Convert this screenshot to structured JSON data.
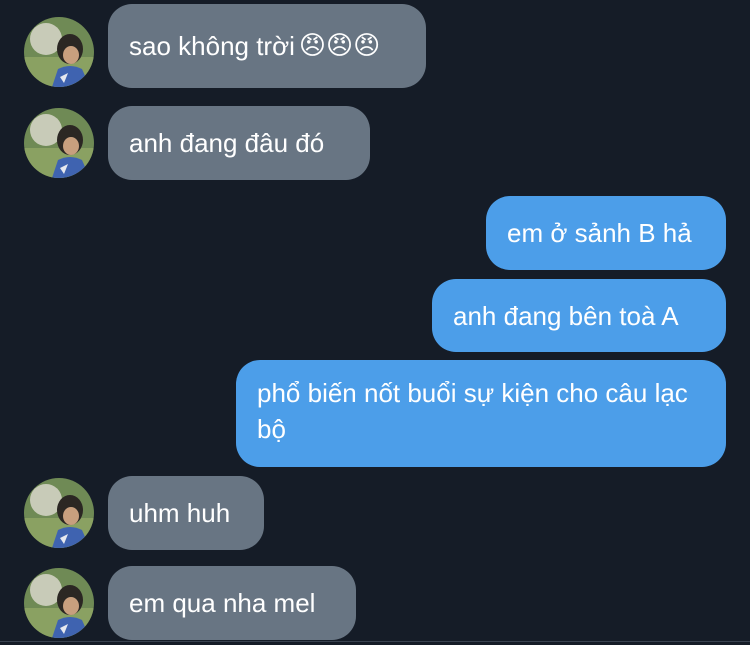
{
  "messages": [
    {
      "sender": "contact",
      "text": "sao không trời",
      "emoji": "😠😠😠"
    },
    {
      "sender": "contact",
      "text": "anh đang đâu đó"
    },
    {
      "sender": "me",
      "text": "em ở sảnh B hả"
    },
    {
      "sender": "me",
      "text": "anh đang bên toà A"
    },
    {
      "sender": "me",
      "text": "phổ biến nốt buổi sự kiện cho câu lạc bộ"
    },
    {
      "sender": "contact",
      "text": "uhm huh"
    },
    {
      "sender": "contact",
      "text": "em qua nha mel"
    }
  ],
  "colors": {
    "background": "#151c27",
    "incoming_bubble": "#687583",
    "outgoing_bubble": "#4c9ee9",
    "text": "#ffffff"
  }
}
